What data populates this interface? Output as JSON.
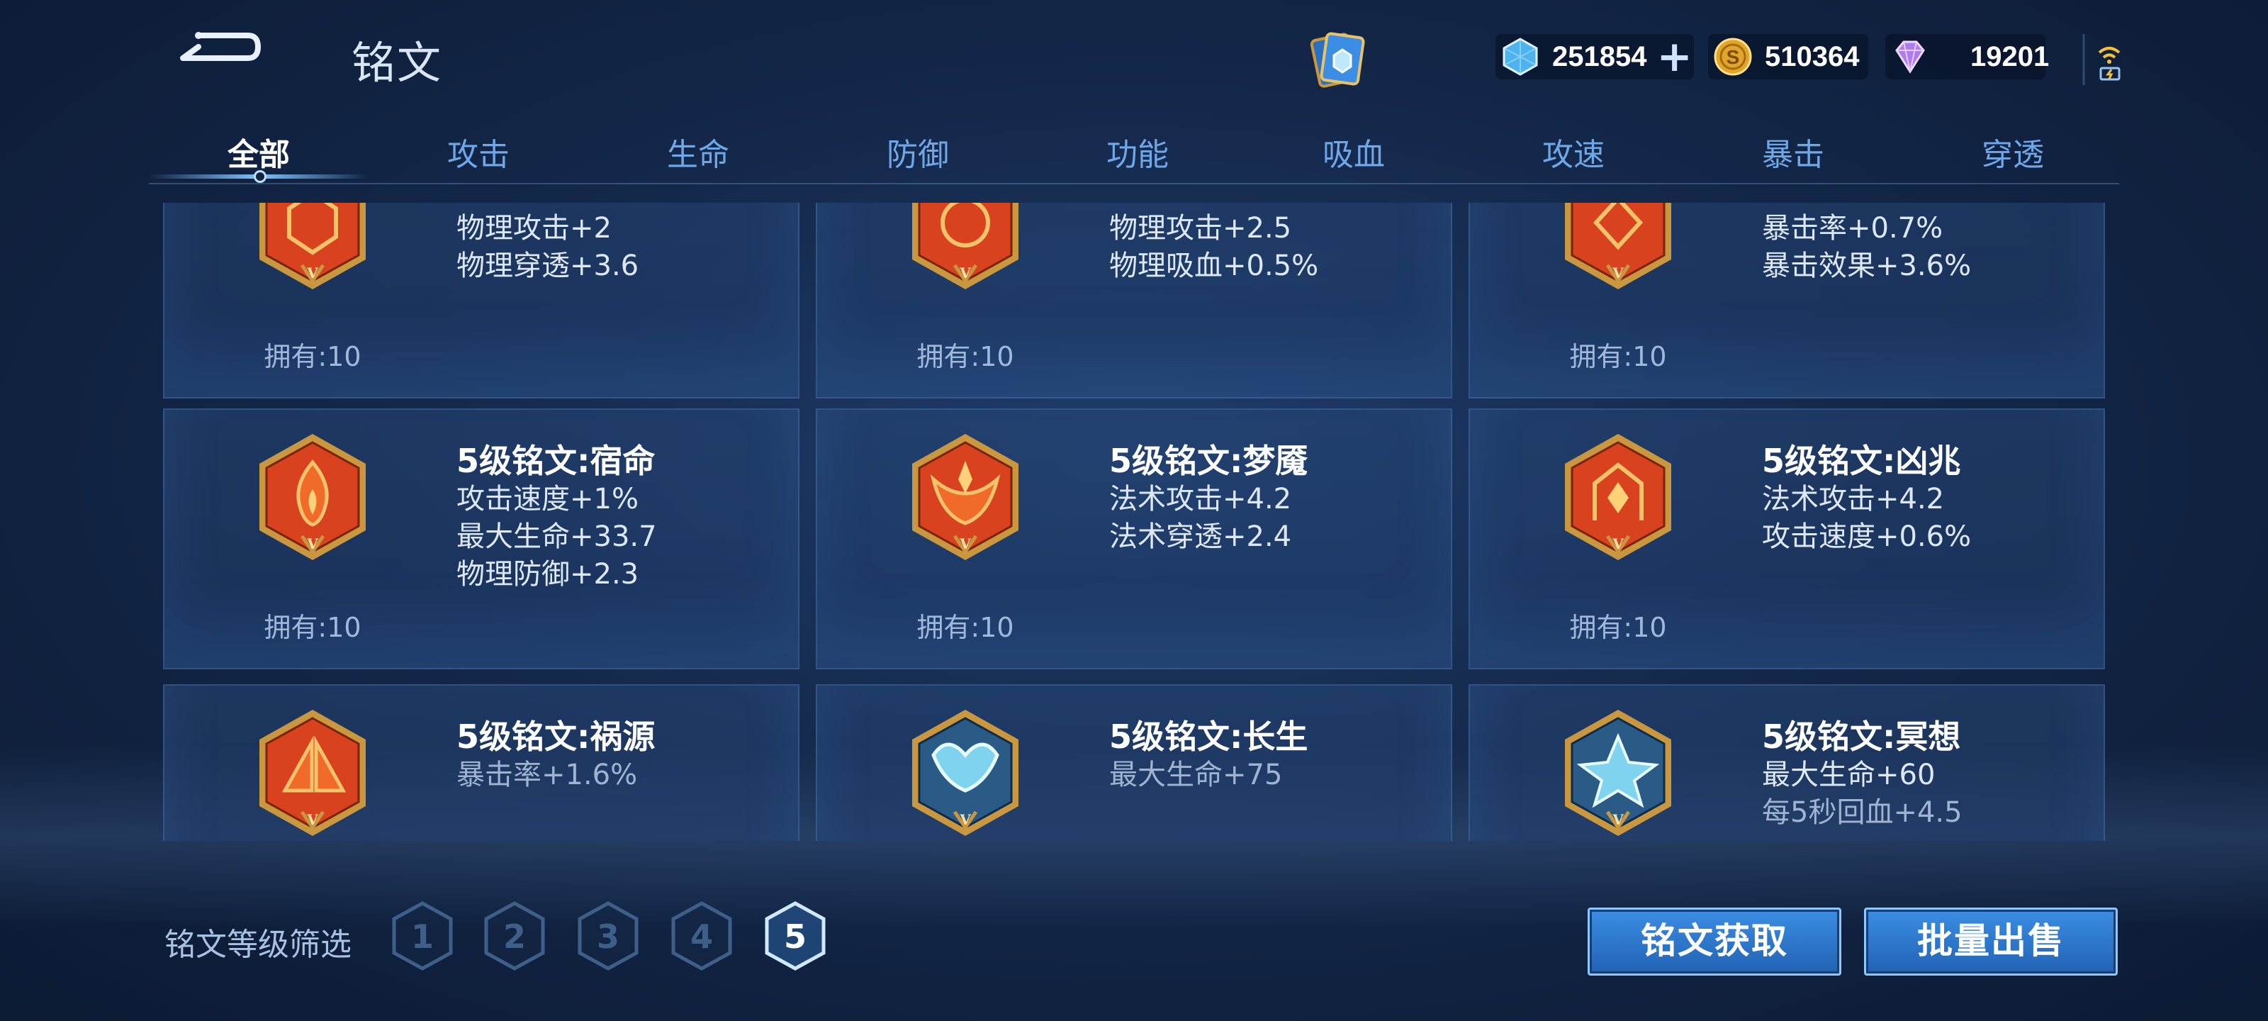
{
  "header": {
    "title": "铭文",
    "currencies": {
      "gem": {
        "value": "251854",
        "icon": "gem-icon"
      },
      "coin": {
        "value": "510364",
        "icon": "gold-coin-icon"
      },
      "diamond": {
        "value": "19201",
        "icon": "diamond-icon"
      }
    },
    "add_label": "+"
  },
  "tabs": [
    {
      "label": "全部",
      "active": true
    },
    {
      "label": "攻击"
    },
    {
      "label": "生命"
    },
    {
      "label": "防御"
    },
    {
      "label": "功能"
    },
    {
      "label": "吸血"
    },
    {
      "label": "攻速"
    },
    {
      "label": "暴击"
    },
    {
      "label": "穿透"
    }
  ],
  "inscriptions": [
    {
      "name": "",
      "stats": [
        "物理攻击+2",
        "物理穿透+3.6"
      ],
      "owned": "拥有:10",
      "color": "red"
    },
    {
      "name": "",
      "stats": [
        "物理攻击+2.5",
        "物理吸血+0.5%"
      ],
      "owned": "拥有:10",
      "color": "red"
    },
    {
      "name": "",
      "stats": [
        "暴击率+0.7%",
        "暴击效果+3.6%"
      ],
      "owned": "拥有:10",
      "color": "red"
    },
    {
      "name": "5级铭文:宿命",
      "stats": [
        "攻击速度+1%",
        "最大生命+33.7",
        "物理防御+2.3"
      ],
      "owned": "拥有:10",
      "color": "red"
    },
    {
      "name": "5级铭文:梦魇",
      "stats": [
        "法术攻击+4.2",
        "法术穿透+2.4"
      ],
      "owned": "拥有:10",
      "color": "red"
    },
    {
      "name": "5级铭文:凶兆",
      "stats": [
        "法术攻击+4.2",
        "攻击速度+0.6%"
      ],
      "owned": "拥有:10",
      "color": "red"
    },
    {
      "name": "5级铭文:祸源",
      "stats": [
        "暴击率+1.6%"
      ],
      "owned": "",
      "color": "red"
    },
    {
      "name": "5级铭文:长生",
      "stats": [
        "最大生命+75"
      ],
      "owned": "",
      "color": "blue"
    },
    {
      "name": "5级铭文:冥想",
      "stats": [
        "最大生命+60",
        "每5秒回血+4.5"
      ],
      "owned": "",
      "color": "blue"
    }
  ],
  "filter": {
    "label": "铭文等级筛选",
    "levels": [
      "1",
      "2",
      "3",
      "4",
      "5"
    ],
    "selected": "5"
  },
  "buttons": {
    "get": "铭文获取",
    "sell": "批量出售"
  },
  "colors": {
    "accent": "#7fc3ff",
    "tab_inactive": "#6fa8e8",
    "button": "#2f7fd8",
    "badge_red": "#d8421e",
    "badge_blue": "#7fd3ef",
    "badge_gold": "#c9973f"
  }
}
